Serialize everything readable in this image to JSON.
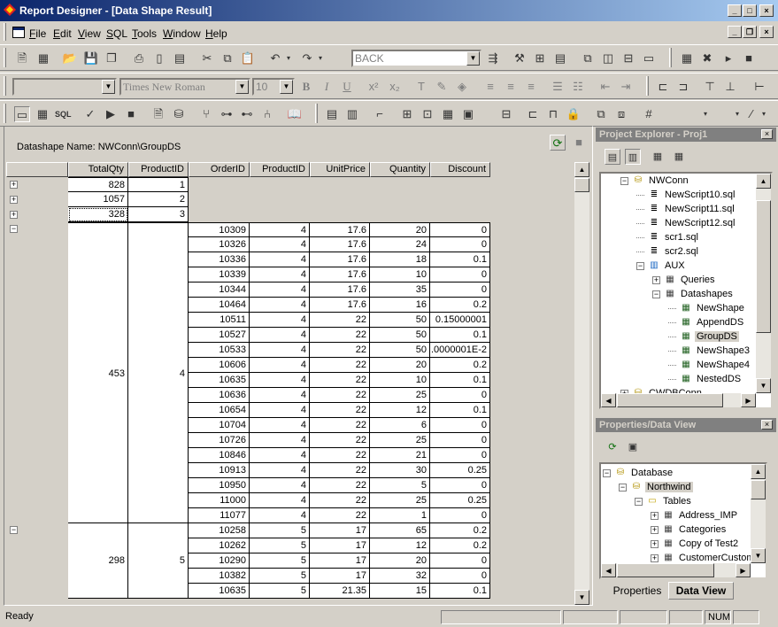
{
  "window": {
    "title": "Report Designer - [Data Shape Result]"
  },
  "menu": [
    {
      "label": "File",
      "u": "F",
      "rest": "ile"
    },
    {
      "label": "Edit",
      "u": "E",
      "rest": "dit"
    },
    {
      "label": "View",
      "u": "V",
      "rest": "iew"
    },
    {
      "label": "SQL",
      "u": "S",
      "rest": "QL"
    },
    {
      "label": "Tools",
      "u": "T",
      "rest": "ools"
    },
    {
      "label": "Window",
      "u": "W",
      "rest": "indow"
    },
    {
      "label": "Help",
      "u": "H",
      "rest": "elp"
    }
  ],
  "toolbar": {
    "back_combo": "BACK",
    "font_combo": "Times New Roman",
    "size_combo": "10",
    "bold": "B",
    "italic": "I",
    "underline": "U"
  },
  "datashape": {
    "name_label": "Datashape Name: NWConn\\GroupDS"
  },
  "grid": {
    "outer_headers": [
      "TotalQty",
      "ProductID"
    ],
    "inner_headers": [
      "OrderID",
      "ProductID",
      "UnitPrice",
      "Quantity",
      "Discount"
    ],
    "collapsed_groups": [
      {
        "total": "828",
        "pid": "1"
      },
      {
        "total": "1057",
        "pid": "2"
      },
      {
        "total": "328",
        "pid": "3"
      }
    ],
    "expanded_groups": [
      {
        "total": "453",
        "pid": "4",
        "rows": [
          [
            "10309",
            "4",
            "17.6",
            "20",
            "0"
          ],
          [
            "10326",
            "4",
            "17.6",
            "24",
            "0"
          ],
          [
            "10336",
            "4",
            "17.6",
            "18",
            "0.1"
          ],
          [
            "10339",
            "4",
            "17.6",
            "10",
            "0"
          ],
          [
            "10344",
            "4",
            "17.6",
            "35",
            "0"
          ],
          [
            "10464",
            "4",
            "17.6",
            "16",
            "0.2"
          ],
          [
            "10511",
            "4",
            "22",
            "50",
            "0.15000001"
          ],
          [
            "10527",
            "4",
            "22",
            "50",
            "0.1"
          ],
          [
            "10533",
            "4",
            "22",
            "50",
            ".0000001E-2"
          ],
          [
            "10606",
            "4",
            "22",
            "20",
            "0.2"
          ],
          [
            "10635",
            "4",
            "22",
            "10",
            "0.1"
          ],
          [
            "10636",
            "4",
            "22",
            "25",
            "0"
          ],
          [
            "10654",
            "4",
            "22",
            "12",
            "0.1"
          ],
          [
            "10704",
            "4",
            "22",
            "6",
            "0"
          ],
          [
            "10726",
            "4",
            "22",
            "25",
            "0"
          ],
          [
            "10846",
            "4",
            "22",
            "21",
            "0"
          ],
          [
            "10913",
            "4",
            "22",
            "30",
            "0.25"
          ],
          [
            "10950",
            "4",
            "22",
            "5",
            "0"
          ],
          [
            "11000",
            "4",
            "22",
            "25",
            "0.25"
          ],
          [
            "11077",
            "4",
            "22",
            "1",
            "0"
          ]
        ]
      },
      {
        "total": "298",
        "pid": "5",
        "rows": [
          [
            "10258",
            "5",
            "17",
            "65",
            "0.2"
          ],
          [
            "10262",
            "5",
            "17",
            "12",
            "0.2"
          ],
          [
            "10290",
            "5",
            "17",
            "20",
            "0"
          ],
          [
            "10382",
            "5",
            "17",
            "32",
            "0"
          ],
          [
            "10635",
            "5",
            "21.35",
            "15",
            "0.1"
          ]
        ]
      }
    ]
  },
  "project_explorer": {
    "title": "Project Explorer - Proj1",
    "nodes": [
      {
        "label": "NWConn",
        "level": 0,
        "icon": "db"
      },
      {
        "label": "NewScript10.sql",
        "level": 1,
        "icon": "script"
      },
      {
        "label": "NewScript11.sql",
        "level": 1,
        "icon": "script"
      },
      {
        "label": "NewScript12.sql",
        "level": 1,
        "icon": "script"
      },
      {
        "label": "scr1.sql",
        "level": 1,
        "icon": "script"
      },
      {
        "label": "scr2.sql",
        "level": 1,
        "icon": "script"
      },
      {
        "label": "AUX",
        "level": 1,
        "icon": "aux"
      },
      {
        "label": "Queries",
        "level": 2,
        "icon": "queries"
      },
      {
        "label": "Datashapes",
        "level": 2,
        "icon": "shapes"
      },
      {
        "label": "NewShape",
        "level": 3,
        "icon": "shape"
      },
      {
        "label": "AppendDS",
        "level": 3,
        "icon": "shape"
      },
      {
        "label": "GroupDS",
        "level": 3,
        "icon": "shape",
        "selected": true
      },
      {
        "label": "NewShape3",
        "level": 3,
        "icon": "shape"
      },
      {
        "label": "NewShape4",
        "level": 3,
        "icon": "shape"
      },
      {
        "label": "NestedDS",
        "level": 3,
        "icon": "shape"
      },
      {
        "label": "CWDBConn",
        "level": 0,
        "icon": "db"
      }
    ]
  },
  "properties": {
    "title": "Properties/Data View",
    "nodes": [
      {
        "label": "Database",
        "level": 0,
        "icon": "db"
      },
      {
        "label": "Northwind",
        "level": 1,
        "icon": "db",
        "selected": true
      },
      {
        "label": "Tables",
        "level": 2,
        "icon": "folder"
      },
      {
        "label": "Address_IMP",
        "level": 3,
        "icon": "table"
      },
      {
        "label": "Categories",
        "level": 3,
        "icon": "table"
      },
      {
        "label": "Copy of Test2",
        "level": 3,
        "icon": "table"
      },
      {
        "label": "CustomerCustome",
        "level": 3,
        "icon": "table"
      }
    ],
    "tabs": [
      "Properties",
      "Data View"
    ]
  },
  "status": {
    "text": "Ready",
    "num": "NUM"
  }
}
